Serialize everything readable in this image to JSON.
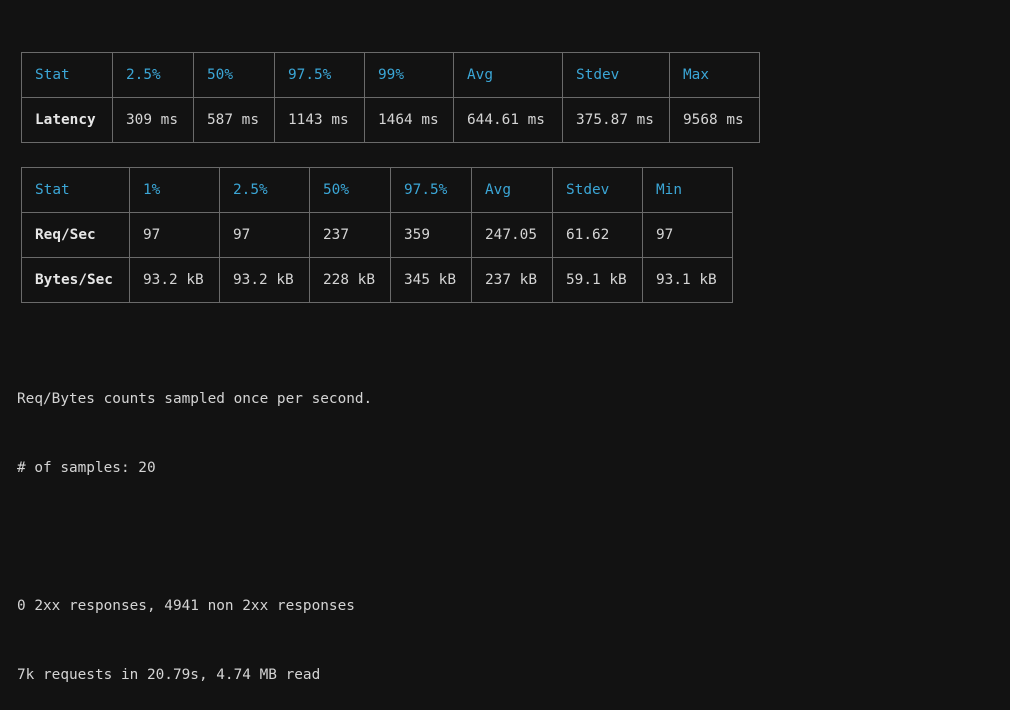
{
  "latency_table": {
    "headers": [
      "Stat",
      "2.5%",
      "50%",
      "97.5%",
      "99%",
      "Avg",
      "Stdev",
      "Max"
    ],
    "rows": [
      {
        "label": "Latency",
        "values": [
          "309 ms",
          "587 ms",
          "1143 ms",
          "1464 ms",
          "644.61 ms",
          "375.87 ms",
          "9568 ms"
        ]
      }
    ]
  },
  "throughput_table": {
    "headers": [
      "Stat",
      "1%",
      "2.5%",
      "50%",
      "97.5%",
      "Avg",
      "Stdev",
      "Min"
    ],
    "rows": [
      {
        "label": "Req/Sec",
        "values": [
          "97",
          "97",
          "237",
          "359",
          "247.05",
          "61.62",
          "97"
        ]
      },
      {
        "label": "Bytes/Sec",
        "values": [
          "93.2 kB",
          "93.2 kB",
          "228 kB",
          "345 kB",
          "237 kB",
          "59.1 kB",
          "93.1 kB"
        ]
      }
    ]
  },
  "summary": {
    "sampling_note": "Req/Bytes counts sampled once per second.",
    "samples": "# of samples: 20",
    "responses": "0 2xx responses, 4941 non 2xx responses",
    "totals": "7k requests in 20.79s, 4.74 MB read"
  }
}
